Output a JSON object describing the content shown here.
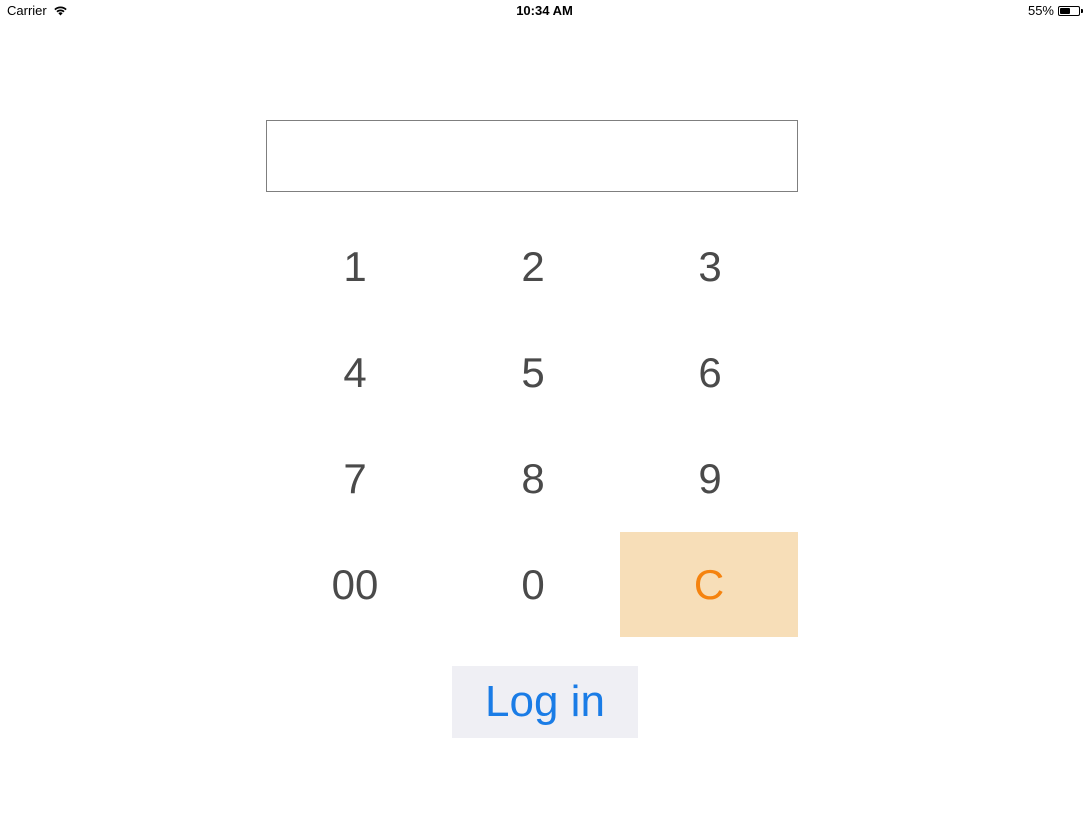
{
  "status_bar": {
    "carrier": "Carrier",
    "time": "10:34 AM",
    "battery_percent": "55%",
    "battery_level": 0.55,
    "icons": {
      "wifi": "wifi-icon",
      "battery": "battery-icon"
    }
  },
  "pin_field": {
    "value": ""
  },
  "keypad": {
    "keys": [
      "1",
      "2",
      "3",
      "4",
      "5",
      "6",
      "7",
      "8",
      "9",
      "00",
      "0",
      "C"
    ]
  },
  "login": {
    "label": "Log in"
  },
  "colors": {
    "key_text": "#4a4a4a",
    "clear_background": "#f7deb8",
    "clear_text": "#f5830f",
    "login_background": "#efeff4",
    "login_text": "#1a7ce6"
  }
}
